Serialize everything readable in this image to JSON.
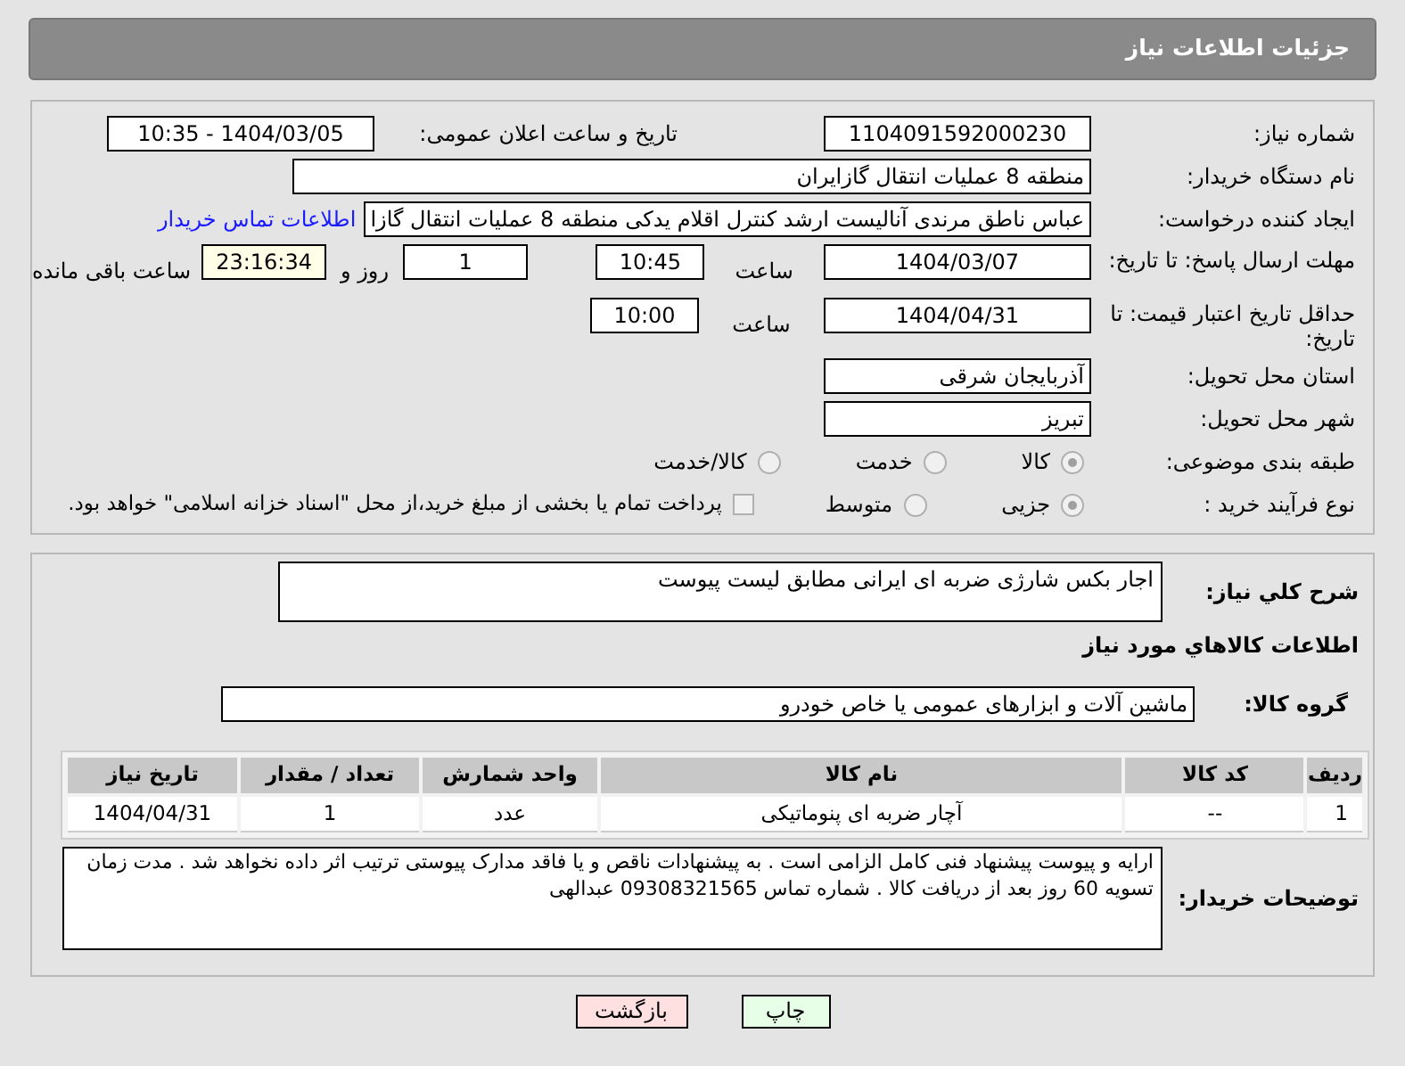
{
  "header": {
    "title": "جزئیات اطلاعات نیاز"
  },
  "need_number": {
    "label": "شماره نیاز:",
    "value": "1104091592000230"
  },
  "announce": {
    "label": "تاریخ و ساعت اعلان عمومی:",
    "value": "1404/03/05 - 10:35"
  },
  "buyer_org": {
    "label": "نام دستگاه خریدار:",
    "value": "منطقه 8 عملیات انتقال گازایران"
  },
  "creator": {
    "label": "ایجاد کننده درخواست:",
    "value": "عباس ناطق مرندی آنالیست ارشد کنترل اقلام یدکی منطقه 8 عملیات انتقال گازا",
    "link": "اطلاعات تماس خریدار"
  },
  "reply_deadline": {
    "label": "مهلت ارسال پاسخ: تا تاریخ:",
    "date": "1404/03/07",
    "time_label": "ساعت",
    "time": "10:45",
    "days": "1",
    "days_label": "روز و",
    "remaining": "23:16:34",
    "remaining_label": "ساعت باقی مانده"
  },
  "price_validity": {
    "label": "حداقل تاریخ اعتبار قیمت: تا تاریخ:",
    "date": "1404/04/31",
    "time_label": "ساعت",
    "time": "10:00"
  },
  "province": {
    "label": "استان محل تحویل:",
    "value": "آذربایجان شرقی"
  },
  "city": {
    "label": "شهر محل تحویل:",
    "value": "تبریز"
  },
  "category": {
    "label": "طبقه بندی موضوعی:",
    "options": [
      {
        "label": "کالا",
        "selected": true
      },
      {
        "label": "خدمت",
        "selected": false
      },
      {
        "label": "کالا/خدمت",
        "selected": false
      }
    ]
  },
  "purchase_type": {
    "label": "نوع فرآیند خرید :",
    "options": [
      {
        "label": "جزیی",
        "selected": true
      },
      {
        "label": "متوسط",
        "selected": false
      }
    ],
    "treasury": {
      "label": "پرداخت تمام یا بخشی از مبلغ خرید،از محل \"اسناد خزانه اسلامی\" خواهد بود.",
      "checked": false
    }
  },
  "description": {
    "label": "شرح کلي نياز:",
    "value": "اجار بکس شارژی ضربه ای ایرانی مطابق لیست پیوست"
  },
  "goods_heading": "اطلاعات کالاهاي مورد نياز",
  "goods_group": {
    "label": "گروه کالا:",
    "value": "ماشین آلات و ابزارهای عمومی یا خاص خودرو"
  },
  "table": {
    "columns": [
      "ردیف",
      "کد کالا",
      "نام کالا",
      "واحد شمارش",
      "تعداد / مقدار",
      "تاریخ نیاز"
    ],
    "rows": [
      [
        "1",
        "--",
        "آچار ضربه ای پنوماتیکی",
        "عدد",
        "1",
        "1404/04/31"
      ]
    ]
  },
  "buyer_notes": {
    "label": "توضیحات خریدار:",
    "value": "ارایه و پیوست پیشنهاد فنی کامل الزامی است . به پیشنهادات ناقص و یا فاقد مدارک پیوستی ترتیب اثر داده نخواهد شد . مدت زمان تسویه 60 روز بعد از دریافت کالا . شماره تماس 09308321565 عبدالهی"
  },
  "buttons": [
    {
      "label": "چاپ",
      "kind": "print"
    },
    {
      "label": "بازگشت",
      "kind": "back"
    }
  ]
}
